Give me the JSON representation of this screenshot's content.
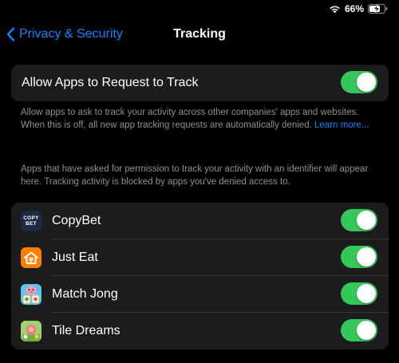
{
  "status": {
    "battery_percent": "66%",
    "wifi_icon": "wifi-icon",
    "battery_icon": "battery-charging-icon"
  },
  "nav": {
    "back_label": "Privacy & Security",
    "title": "Tracking"
  },
  "allow_section": {
    "label": "Allow Apps to Request to Track",
    "enabled": true,
    "footnote": "Allow apps to ask to track your activity across other companies' apps and websites. When this is off, all new app tracking requests are automatically denied.",
    "learn_more": "Learn more..."
  },
  "apps_footnote": "Apps that have asked for permission to track your activity with an identifier will appear here. Tracking activity is blocked by apps you've denied access to.",
  "apps": [
    {
      "name": "CopyBet",
      "enabled": true,
      "icon": "copybet-icon",
      "icon_text_1": "COPY",
      "icon_text_2": "BET"
    },
    {
      "name": "Just Eat",
      "enabled": true,
      "icon": "just-eat-icon"
    },
    {
      "name": "Match Jong",
      "enabled": true,
      "icon": "match-jong-icon"
    },
    {
      "name": "Tile Dreams",
      "enabled": true,
      "icon": "tile-dreams-icon"
    }
  ],
  "colors": {
    "accent": "#0a84ff",
    "toggle_on": "#34c759",
    "cell_bg": "#1c1c1e",
    "footnote": "#8e8e93"
  }
}
